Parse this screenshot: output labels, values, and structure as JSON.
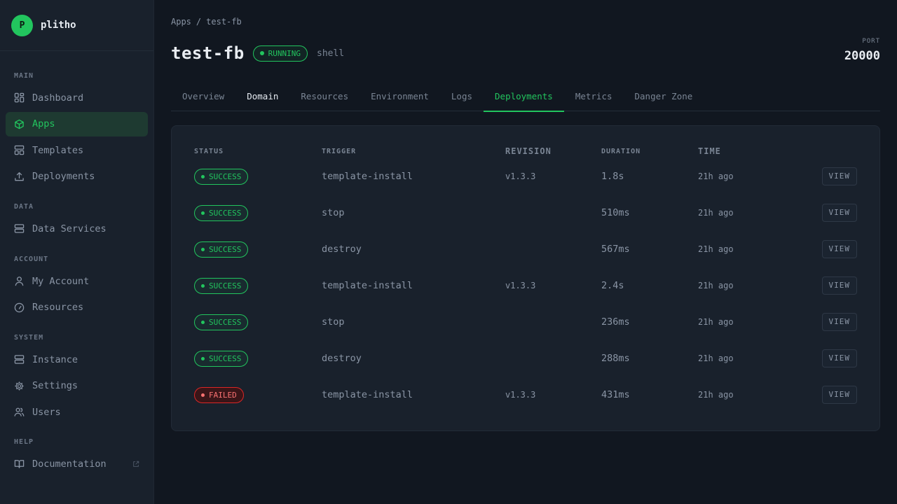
{
  "brand": {
    "initial": "P",
    "name": "plitho"
  },
  "sidebar": {
    "sections": [
      {
        "heading": "MAIN",
        "items": [
          {
            "label": "Dashboard",
            "icon": "dashboard-icon"
          },
          {
            "label": "Apps",
            "icon": "cube-icon",
            "active": true
          },
          {
            "label": "Templates",
            "icon": "template-icon"
          },
          {
            "label": "Deployments",
            "icon": "upload-icon"
          }
        ]
      },
      {
        "heading": "DATA",
        "items": [
          {
            "label": "Data Services",
            "icon": "database-icon"
          }
        ]
      },
      {
        "heading": "ACCOUNT",
        "items": [
          {
            "label": "My Account",
            "icon": "user-icon"
          },
          {
            "label": "Resources",
            "icon": "gauge-icon"
          }
        ]
      },
      {
        "heading": "SYSTEM",
        "items": [
          {
            "label": "Instance",
            "icon": "server-icon"
          },
          {
            "label": "Settings",
            "icon": "gear-icon"
          },
          {
            "label": "Users",
            "icon": "users-icon"
          }
        ]
      },
      {
        "heading": "HELP",
        "items": [
          {
            "label": "Documentation",
            "icon": "book-icon",
            "external": true
          }
        ]
      }
    ]
  },
  "breadcrumb": {
    "root": "Apps",
    "separator": "/",
    "current": "test-fb"
  },
  "app": {
    "name": "test-fb",
    "status": "RUNNING",
    "type": "shell"
  },
  "port": {
    "label": "PORT",
    "value": "20000"
  },
  "tabs": [
    "Overview",
    "Domain",
    "Resources",
    "Environment",
    "Logs",
    "Deployments",
    "Metrics",
    "Danger Zone"
  ],
  "table": {
    "headers": [
      "STATUS",
      "TRIGGER",
      "REVISION",
      "DURATION",
      "TIME"
    ],
    "rows": [
      {
        "status": "SUCCESS",
        "trigger": "template-install",
        "revision": "v1.3.3",
        "duration": "1.8s",
        "time": "21h ago",
        "action": "VIEW"
      },
      {
        "status": "SUCCESS",
        "trigger": "stop",
        "revision": "",
        "duration": "510ms",
        "time": "21h ago",
        "action": "VIEW"
      },
      {
        "status": "SUCCESS",
        "trigger": "destroy",
        "revision": "",
        "duration": "567ms",
        "time": "21h ago",
        "action": "VIEW"
      },
      {
        "status": "SUCCESS",
        "trigger": "template-install",
        "revision": "v1.3.3",
        "duration": "2.4s",
        "time": "21h ago",
        "action": "VIEW"
      },
      {
        "status": "SUCCESS",
        "trigger": "stop",
        "revision": "",
        "duration": "236ms",
        "time": "21h ago",
        "action": "VIEW"
      },
      {
        "status": "SUCCESS",
        "trigger": "destroy",
        "revision": "",
        "duration": "288ms",
        "time": "21h ago",
        "action": "VIEW"
      },
      {
        "status": "FAILED",
        "trigger": "template-install",
        "revision": "v1.3.3",
        "duration": "431ms",
        "time": "21h ago",
        "action": "VIEW"
      }
    ]
  },
  "colors": {
    "accent": "#22c55e",
    "failed": "#f87171",
    "background": "#111720",
    "sidebar": "#19212c"
  }
}
